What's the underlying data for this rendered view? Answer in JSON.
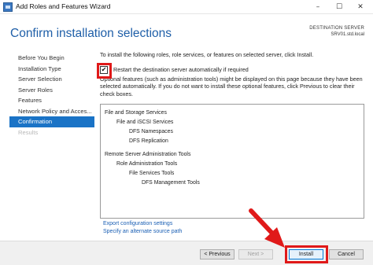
{
  "window": {
    "title": "Add Roles and Features Wizard",
    "controls": {
      "minimize": "–",
      "maximize": "☐",
      "close": "✕"
    }
  },
  "header": {
    "page_title": "Confirm installation selections",
    "destination_label": "DESTINATION SERVER",
    "destination_server": "SRV01.std.local"
  },
  "sidebar": {
    "items": [
      {
        "label": "Before You Begin",
        "state": "normal"
      },
      {
        "label": "Installation Type",
        "state": "normal"
      },
      {
        "label": "Server Selection",
        "state": "normal"
      },
      {
        "label": "Server Roles",
        "state": "normal"
      },
      {
        "label": "Features",
        "state": "normal"
      },
      {
        "label": "Network Policy and Acces...",
        "state": "normal"
      },
      {
        "label": "Confirmation",
        "state": "active"
      },
      {
        "label": "Results",
        "state": "disabled"
      }
    ]
  },
  "content": {
    "intro": "To install the following roles, role services, or features on selected server, click Install.",
    "restart_label": "Restart the destination server automatically if required",
    "restart_checked": true,
    "checkmark": "✔",
    "optional_note": "Optional features (such as administration tools) might be displayed on this page because they have been selected automatically. If you do not want to install these optional features, click Previous to clear their check boxes.",
    "tree": [
      "File and Storage Services",
      "File and iSCSI Services",
      "DFS Namespaces",
      "DFS Replication",
      "Remote Server Administration Tools",
      "Role Administration Tools",
      "File Services Tools",
      "DFS Management Tools"
    ],
    "links": {
      "export": "Export configuration settings",
      "alternate_source": "Specify an alternate source path"
    }
  },
  "buttons": {
    "previous": "< Previous",
    "next": "Next >",
    "install": "Install",
    "cancel": "Cancel"
  },
  "annotation": {
    "color": "#e01919"
  }
}
